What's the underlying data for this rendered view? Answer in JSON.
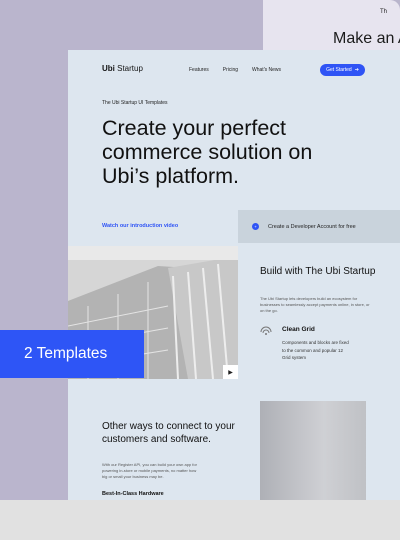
{
  "background": {
    "corner_small_text": "Th",
    "corner_big_text": "Make an A"
  },
  "nav": {
    "logo_bold": "Ubi",
    "logo_rest": " Startup",
    "links": [
      "Features",
      "Pricing",
      "What's News"
    ],
    "cta_label": "Get Started",
    "cta_icon": "arrow-right-icon"
  },
  "hero": {
    "eyebrow": "The Ubi Startup UI Templates",
    "title": "Create your perfect commerce solution on Ubi’s platform.",
    "video_link": "Watch our introduction video"
  },
  "dev_bar": {
    "label": "Create a Developer Account for free",
    "icon": "plus-icon"
  },
  "build": {
    "title": "Build with The Ubi Startup",
    "description": "The Ubi Startup lets developers build an ecosystem for businesses to seamlessly accept payments online, in store, or on the go.",
    "feature_title": "Clean Grid",
    "feature_desc": "Components and blocks are fixed to the common and popular 12 Grid system",
    "feature_icon": "wifi-signal-icon"
  },
  "other": {
    "title": "Other ways to connect to your customers and software.",
    "description": "With our Register API, you can build your own app for powering in-store or mobile payments, no matter how big or small your business may be.",
    "hardware_label": "Best-In-Class Hardware"
  },
  "media": {
    "play_icon": "play-icon"
  },
  "badge": {
    "label": "2 Templates"
  },
  "colors": {
    "accent": "#2f54f5",
    "card_bg": "#dde6ef",
    "left_bg": "#bab5cd",
    "right_bg": "#e7e4ef"
  }
}
